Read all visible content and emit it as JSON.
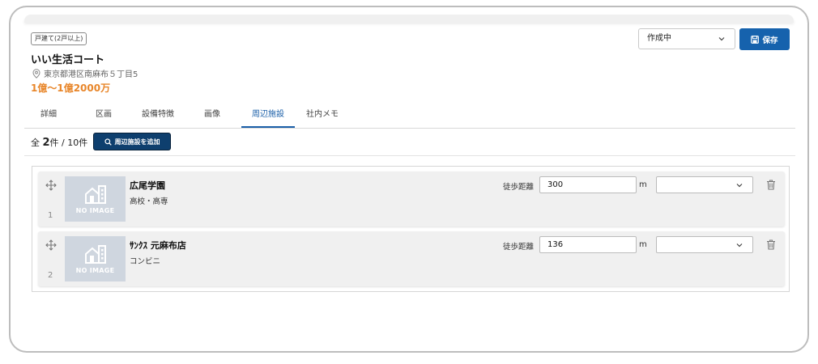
{
  "property": {
    "type_badge": "戸建て(2戸以上)",
    "title": "いい生活コート",
    "address": "東京都港区南麻布５丁目5",
    "price": "1億〜1億2000万"
  },
  "header": {
    "status_value": "作成中",
    "save_label": "保存"
  },
  "tabs": [
    {
      "label": "詳細"
    },
    {
      "label": "区画"
    },
    {
      "label": "設備特徴"
    },
    {
      "label": "画像"
    },
    {
      "label": "周辺施設",
      "active": true
    },
    {
      "label": "社内メモ"
    }
  ],
  "list": {
    "count_prefix": "全",
    "count_value": "2",
    "count_suffix": "件 / 10件",
    "add_button_label": "周辺施設を追加"
  },
  "facilities": [
    {
      "index": "1",
      "name": "広尾学園",
      "category": "高校・高専",
      "distance_label": "徒歩距離",
      "distance": "300",
      "unit": "m",
      "no_image": "NO IMAGE"
    },
    {
      "index": "2",
      "name": "ｻﾝｸｽ 元麻布店",
      "category": "コンビニ",
      "distance_label": "徒歩距離",
      "distance": "136",
      "unit": "m",
      "no_image": "NO IMAGE"
    }
  ],
  "colors": {
    "primary": "#1662ad",
    "accent_price": "#e8862a",
    "active_tab": "#1a5fa8"
  }
}
